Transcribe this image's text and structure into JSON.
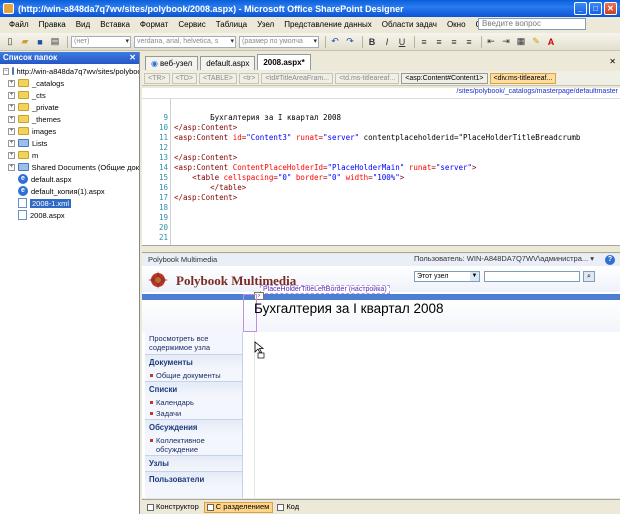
{
  "window": {
    "title": "(http://win-a848da7q7wv/sites/polybook/2008.aspx) - Microsoft Office SharePoint Designer"
  },
  "menu": [
    "Файл",
    "Правка",
    "Вид",
    "Вставка",
    "Формат",
    "Сервис",
    "Таблица",
    "Узел",
    "Представление данных",
    "Области задач",
    "Окно",
    "Справка"
  ],
  "help_search_placeholder": "Введите вопрос",
  "toolbar": {
    "style_combo": "(нет)",
    "font_combo": "verdana, arial, helvetica, s",
    "size_combo": "(размер по умолча"
  },
  "folder_list": {
    "title": "Список папок",
    "root": "http://win-a848da7q7wv/sites/polybook",
    "folders": [
      "_catalogs",
      "_cts",
      "_private",
      "_themes",
      "images",
      "Lists",
      "m",
      "Shared Documents (Общие док"
    ],
    "files": [
      "default.aspx",
      "default_копия(1).aspx",
      "2008-1.xml",
      "2008.aspx"
    ],
    "selected_file": "2008-1.xml"
  },
  "tabs": [
    {
      "label": "веб-узел",
      "active": false
    },
    {
      "label": "default.aspx",
      "active": false
    },
    {
      "label": "2008.aspx*",
      "active": true
    }
  ],
  "quick_tags": [
    "<TR>",
    "<TD>",
    "<TABLE>",
    "<tr>",
    "<td#TitleAreaFram...",
    "<td.ms-titleareaf...",
    "<asp:Content#Content1>",
    "<div.ms-titleareaf..."
  ],
  "path_line": "/sites/polybook/_catalogs/masterpage/defaultmaster",
  "code_lines": [
    {
      "n": "9",
      "text": "        Бухгалтерия за I квартал 2008"
    },
    {
      "n": "10",
      "text": "</asp:Content>"
    },
    {
      "n": "11",
      "text": "<asp:Content id=\"Content3\" runat=\"server\" contentplaceholderid=\"PlaceHolderTitleBreadcrumb"
    },
    {
      "n": "12",
      "text": ""
    },
    {
      "n": "13",
      "text": "</asp:Content>"
    },
    {
      "n": "14",
      "text": "<asp:Content ContentPlaceHolderId=\"PlaceHolderMain\" runat=\"server\">"
    },
    {
      "n": "15",
      "text": "    <table cellspacing=\"0\" border=\"0\" width=\"100%\">"
    },
    {
      "n": "16",
      "text": "        </table>"
    },
    {
      "n": "17",
      "text": "</asp:Content>"
    },
    {
      "n": "18",
      "text": ""
    },
    {
      "n": "19",
      "text": ""
    },
    {
      "n": "20",
      "text": ""
    },
    {
      "n": "21",
      "text": ""
    }
  ],
  "site": {
    "top_left": "Polybook Multimedia",
    "user_text": "Пользователь: WIN-A848DA7Q7WV\\администра... ▾",
    "logo_text": "Polybook Multimedia",
    "search_scope": "Этот узел",
    "placeholder_label": "PlaceHolderTitleLeftBorder (настройка)",
    "page_title": "Бухгалтерия за I квартал 2008",
    "view_all": "Просмотреть все содержимое узла",
    "nav": [
      {
        "heading": "Документы",
        "items": [
          "Общие документы"
        ]
      },
      {
        "heading": "Списки",
        "items": [
          "Календарь",
          "Задачи"
        ]
      },
      {
        "heading": "Обсуждения",
        "items": [
          "Коллективное обсуждение"
        ]
      },
      {
        "heading": "Узлы",
        "items": []
      },
      {
        "heading": "Пользователи",
        "items": []
      }
    ]
  },
  "view_buttons": [
    {
      "label": "Конструктор",
      "active": false
    },
    {
      "label": "С разделением",
      "active": true
    },
    {
      "label": "Код",
      "active": false
    }
  ]
}
